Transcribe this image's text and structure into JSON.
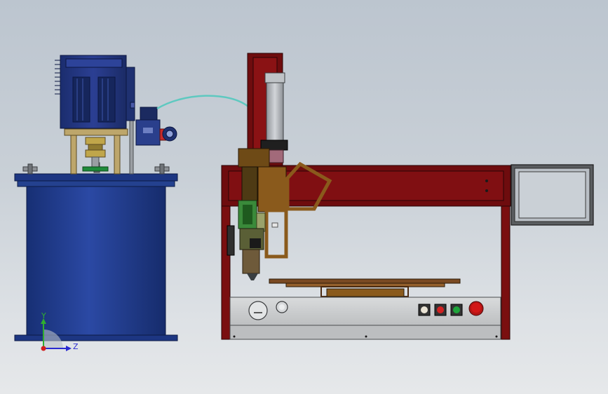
{
  "viewport": {
    "background_top": "#bcc5cf",
    "background_bottom": "#e6e8ea"
  },
  "triad": {
    "y_label": "Y",
    "z_label": "Z",
    "y_color": "#2fae2f",
    "z_color": "#2a2ad0",
    "origin_color": "#d21e1e"
  },
  "palette": {
    "tank_blue": "#1f3a8a",
    "motor_blue": "#23377d",
    "frame_red": "#7a0f10",
    "bronze": "#8a5a1c",
    "steel": "#a8acb0",
    "panel_gray": "#c9cbcc",
    "dark": "#1a1a1a",
    "hose": "#5ec9c0"
  },
  "machine": {
    "tank": {
      "type": "dispensing-tank"
    },
    "gantry": {
      "type": "xyz-gantry"
    },
    "control_panel": {
      "buttons": [
        {
          "name": "start-button",
          "color": "#e9e3d4"
        },
        {
          "name": "stop-button",
          "color": "#d22222"
        },
        {
          "name": "run-button",
          "color": "#1ea43a"
        },
        {
          "name": "emergency-stop-button",
          "color": "#d21717"
        }
      ],
      "knobs": [
        {
          "name": "pressure-gauge"
        },
        {
          "name": "selector-knob"
        }
      ]
    },
    "monitor": {
      "type": "display-screen"
    }
  }
}
